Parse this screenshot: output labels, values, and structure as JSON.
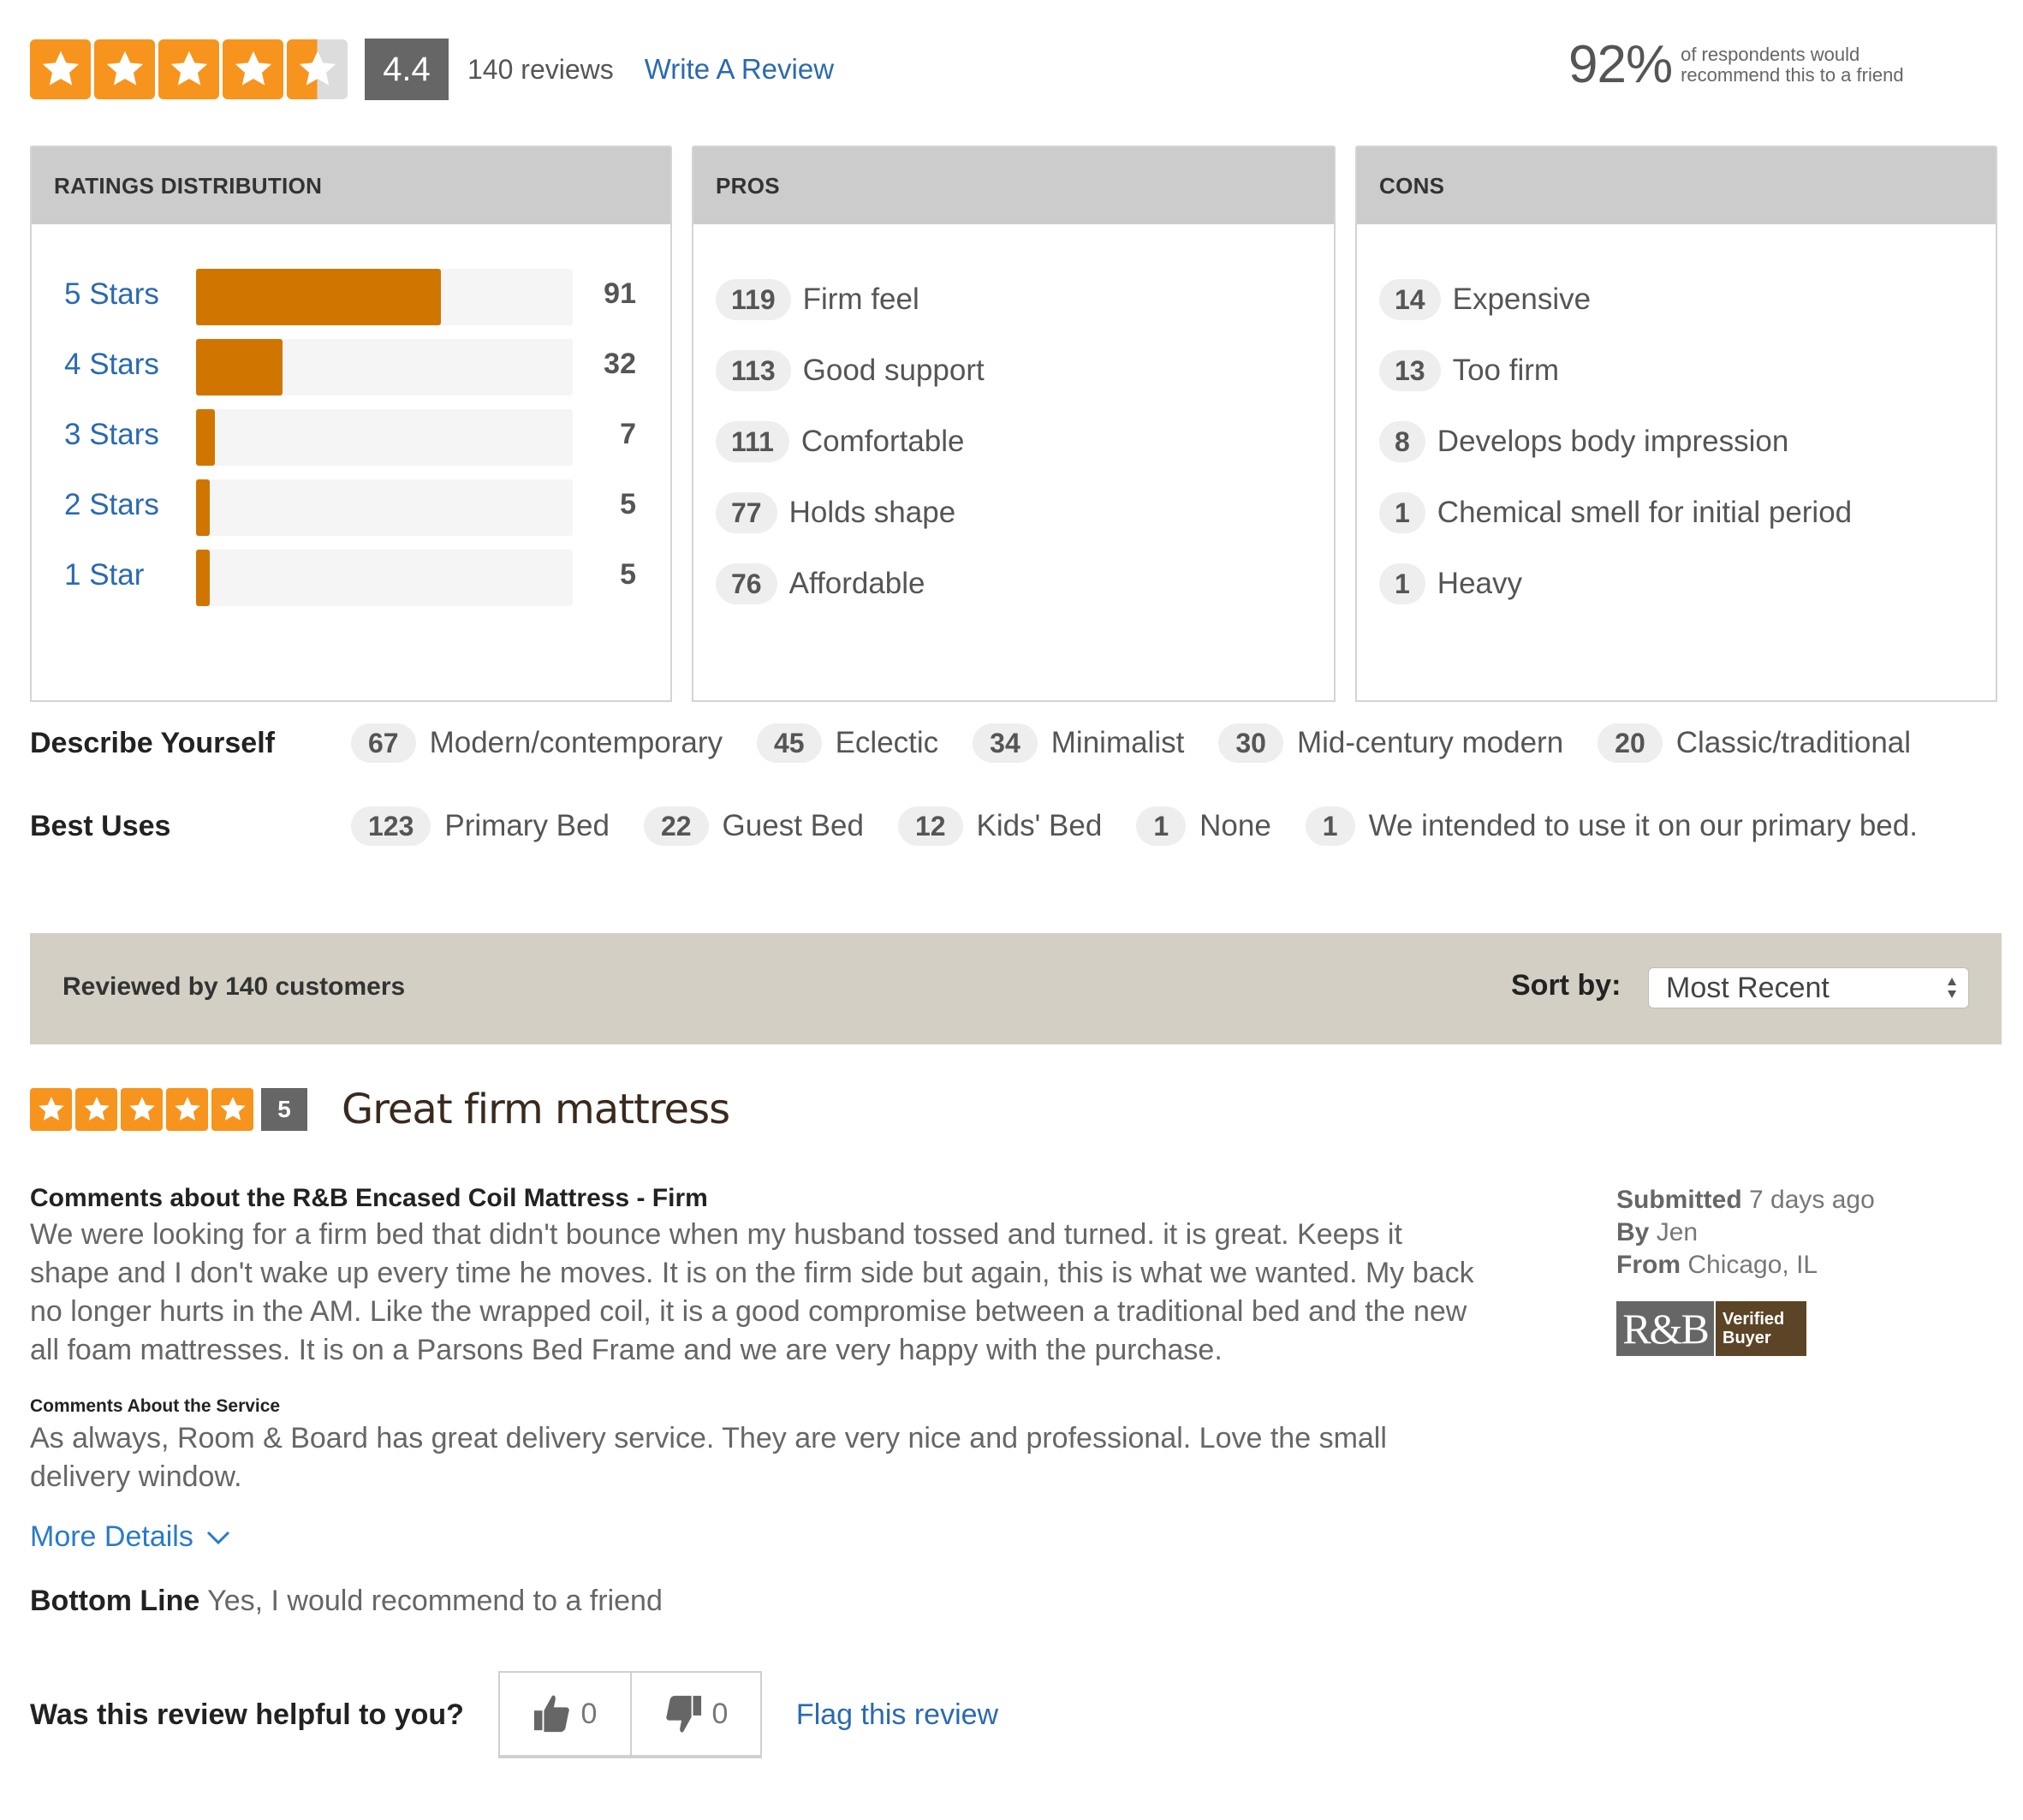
{
  "summary": {
    "average_rating": 4.4,
    "rating_display": "4.4",
    "stars_filled": 4.4,
    "stars_max": 5,
    "review_count_label": "140 reviews",
    "write_review_label": "Write A Review",
    "recommend_percent": "92%",
    "recommend_text_line1": "of respondents would",
    "recommend_text_line2": "recommend this to a friend"
  },
  "colors": {
    "star_orange": "#f7941d",
    "bar_orange": "#d07600",
    "link_blue": "#2a6ab0",
    "badge_gray": "#666666",
    "verified_brown": "#5c4426",
    "sort_bar_bg": "#d3cfc4"
  },
  "ratings_distribution": {
    "title": "RATINGS DISTRIBUTION",
    "total": 140,
    "rows": [
      {
        "label": "5 Stars",
        "count": 91,
        "count_label": "91"
      },
      {
        "label": "4 Stars",
        "count": 32,
        "count_label": "32"
      },
      {
        "label": "3 Stars",
        "count": 7,
        "count_label": "7"
      },
      {
        "label": "2 Stars",
        "count": 5,
        "count_label": "5"
      },
      {
        "label": "1 Star",
        "count": 5,
        "count_label": "5"
      }
    ]
  },
  "pros": {
    "title": "PROS",
    "items": [
      {
        "count": "119",
        "label": "Firm feel"
      },
      {
        "count": "113",
        "label": "Good support"
      },
      {
        "count": "111",
        "label": "Comfortable"
      },
      {
        "count": "77",
        "label": "Holds shape"
      },
      {
        "count": "76",
        "label": "Affordable"
      }
    ]
  },
  "cons": {
    "title": "CONS",
    "items": [
      {
        "count": "14",
        "label": "Expensive"
      },
      {
        "count": "13",
        "label": "Too firm"
      },
      {
        "count": "8",
        "label": "Develops body impression"
      },
      {
        "count": "1",
        "label": "Chemical smell for initial period"
      },
      {
        "count": "1",
        "label": "Heavy"
      }
    ]
  },
  "describe_yourself": {
    "title": "Describe Yourself",
    "items": [
      {
        "count": "67",
        "label": "Modern/contemporary"
      },
      {
        "count": "45",
        "label": "Eclectic"
      },
      {
        "count": "34",
        "label": "Minimalist"
      },
      {
        "count": "30",
        "label": "Mid-century modern"
      },
      {
        "count": "20",
        "label": "Classic/traditional"
      }
    ]
  },
  "best_uses": {
    "title": "Best Uses",
    "items": [
      {
        "count": "123",
        "label": "Primary Bed"
      },
      {
        "count": "22",
        "label": "Guest Bed"
      },
      {
        "count": "12",
        "label": "Kids' Bed"
      },
      {
        "count": "1",
        "label": "None"
      },
      {
        "count": "1",
        "label": "We intended to use it on our primary bed."
      }
    ]
  },
  "review_bar": {
    "reviewed_by": "Reviewed by 140 customers",
    "sort_label": "Sort by:",
    "sort_selected": "Most Recent"
  },
  "review": {
    "rating": 5,
    "rating_display": "5",
    "title": "Great firm mattress",
    "product_comments_label": "Comments about the R&B Encased Coil Mattress - Firm",
    "product_comments": "We were looking for a firm bed that didn't bounce when my husband tossed and turned. it is great. Keeps it shape and I don't wake up every time he moves. It is on the firm side but again, this is what we wanted. My back no longer hurts in the AM. Like the wrapped coil, it is a good compromise between a traditional bed and the new all foam mattresses. It is on a Parsons Bed Frame and we are very happy with the purchase.",
    "service_comments_label": "Comments About the Service",
    "service_comments": "As always, Room & Board has great delivery service. They are very nice and professional. Love the small delivery window.",
    "more_details_label": "More Details",
    "bottom_line_label": "Bottom Line",
    "bottom_line_value": "Yes, I would recommend to a friend",
    "helpful_question": "Was this review helpful to you?",
    "helpful_yes_count": "0",
    "helpful_no_count": "0",
    "flag_label": "Flag this review",
    "submitted_label": "Submitted",
    "submitted_value": "7 days ago",
    "by_label": "By",
    "by_value": "Jen",
    "from_label": "From",
    "from_value": "Chicago, IL",
    "verified_logo": "R&B",
    "verified_line1": "Verified",
    "verified_line2": "Buyer"
  }
}
